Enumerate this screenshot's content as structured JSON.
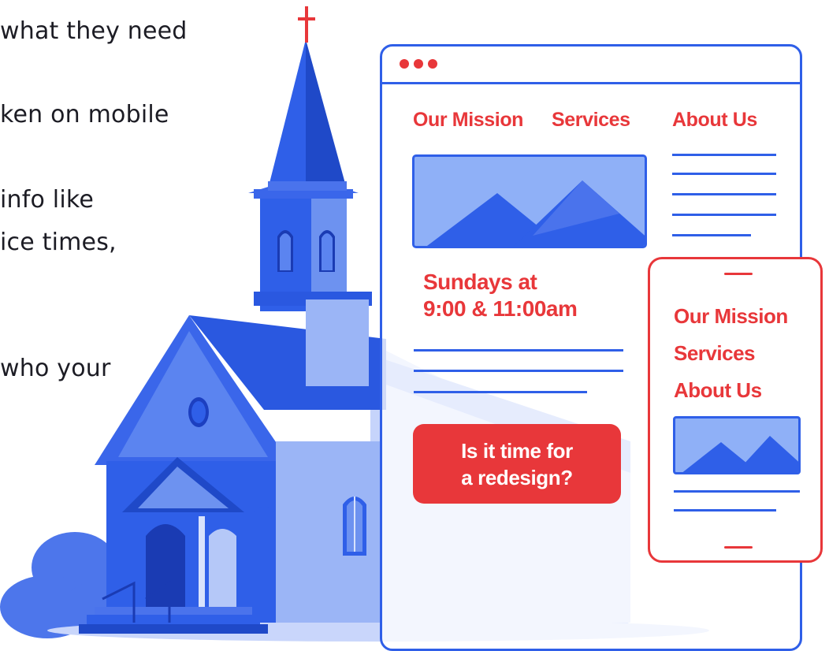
{
  "background_text": [
    "what they need",
    "ken on mobile",
    " info like",
    "ice times,",
    "who your"
  ],
  "desktop": {
    "nav": [
      "Our Mission",
      "Services",
      "About Us"
    ],
    "schedule_line1": "Sundays at",
    "schedule_line2": "9:00 & 11:00am",
    "cta_line1": "Is it time for",
    "cta_line2": "a redesign?"
  },
  "mobile": {
    "nav": [
      "Our Mission",
      "Services",
      "About Us"
    ]
  },
  "colors": {
    "accent_red": "#e8373a",
    "brand_blue": "#2f5fe8",
    "light_blue": "#8fb0f7"
  },
  "icons": [
    "cross-icon",
    "window-dots-icon",
    "mountain-image-icon"
  ]
}
